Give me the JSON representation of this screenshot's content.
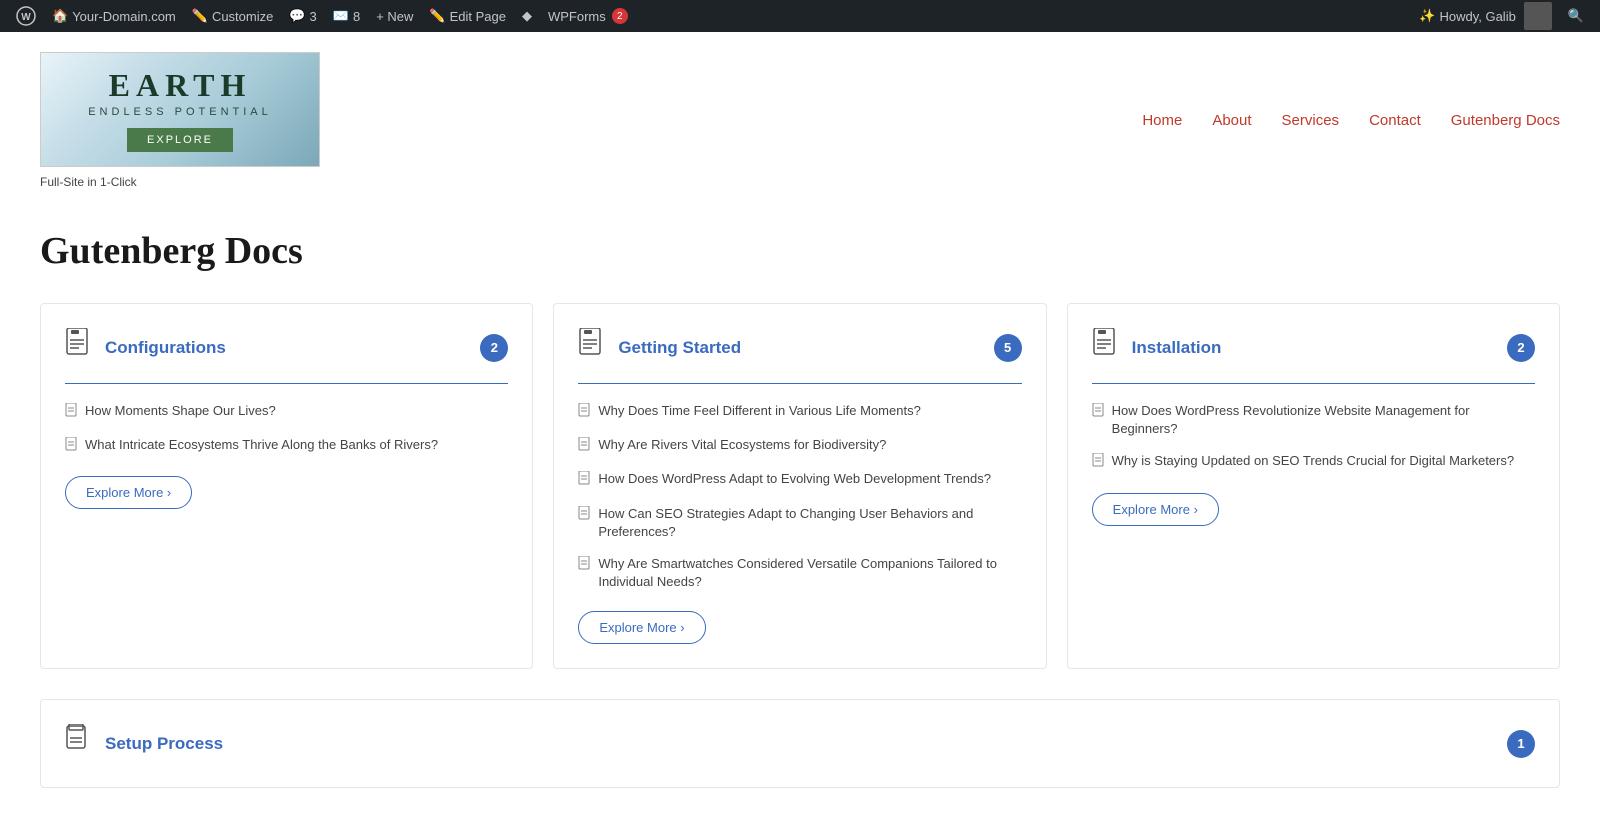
{
  "adminBar": {
    "siteName": "Your-Domain.com",
    "customize": "Customize",
    "commentsCount": "3",
    "messagesCount": "8",
    "newLabel": "+ New",
    "editPage": "Edit Page",
    "wpforms": "WPForms",
    "wpformsBadge": "2",
    "howdy": "Howdy, Galib",
    "searchIcon": "🔍",
    "wordpressIcon": "W"
  },
  "header": {
    "logoTitle": "EARTH",
    "logoSub": "ENDLESS POTENTIAL",
    "logoBtn": "EXPLORE",
    "logoTagline": "Full-Site in 1-Click",
    "nav": [
      {
        "label": "Home",
        "id": "home"
      },
      {
        "label": "About",
        "id": "about"
      },
      {
        "label": "Services",
        "id": "services"
      },
      {
        "label": "Contact",
        "id": "contact"
      },
      {
        "label": "Gutenberg Docs",
        "id": "gutenberg-docs"
      }
    ]
  },
  "page": {
    "title": "Gutenberg Docs",
    "cards": [
      {
        "id": "configurations",
        "icon": "📄",
        "title": "Configurations",
        "count": "2",
        "items": [
          "How Moments Shape Our Lives?",
          "What Intricate Ecosystems Thrive Along the Banks of Rivers?"
        ],
        "exploreLabel": "Explore More ›"
      },
      {
        "id": "getting-started",
        "icon": "📄",
        "title": "Getting Started",
        "count": "5",
        "items": [
          "Why Does Time Feel Different in Various Life Moments?",
          "Why Are Rivers Vital Ecosystems for Biodiversity?",
          "How Does WordPress Adapt to Evolving Web Development Trends?",
          "How Can SEO Strategies Adapt to Changing User Behaviors and Preferences?",
          "Why Are Smartwatches Considered Versatile Companions Tailored to Individual Needs?"
        ],
        "exploreLabel": "Explore More ›"
      },
      {
        "id": "installation",
        "icon": "📄",
        "title": "Installation",
        "count": "2",
        "items": [
          "How Does WordPress Revolutionize Website Management for Beginners?",
          "Why is Staying Updated on SEO Trends Crucial for Digital Marketers?"
        ],
        "exploreLabel": "Explore More ›"
      }
    ],
    "bottomCard": {
      "id": "setup-process",
      "icon": "📄",
      "title": "Setup Process",
      "count": "1"
    }
  }
}
